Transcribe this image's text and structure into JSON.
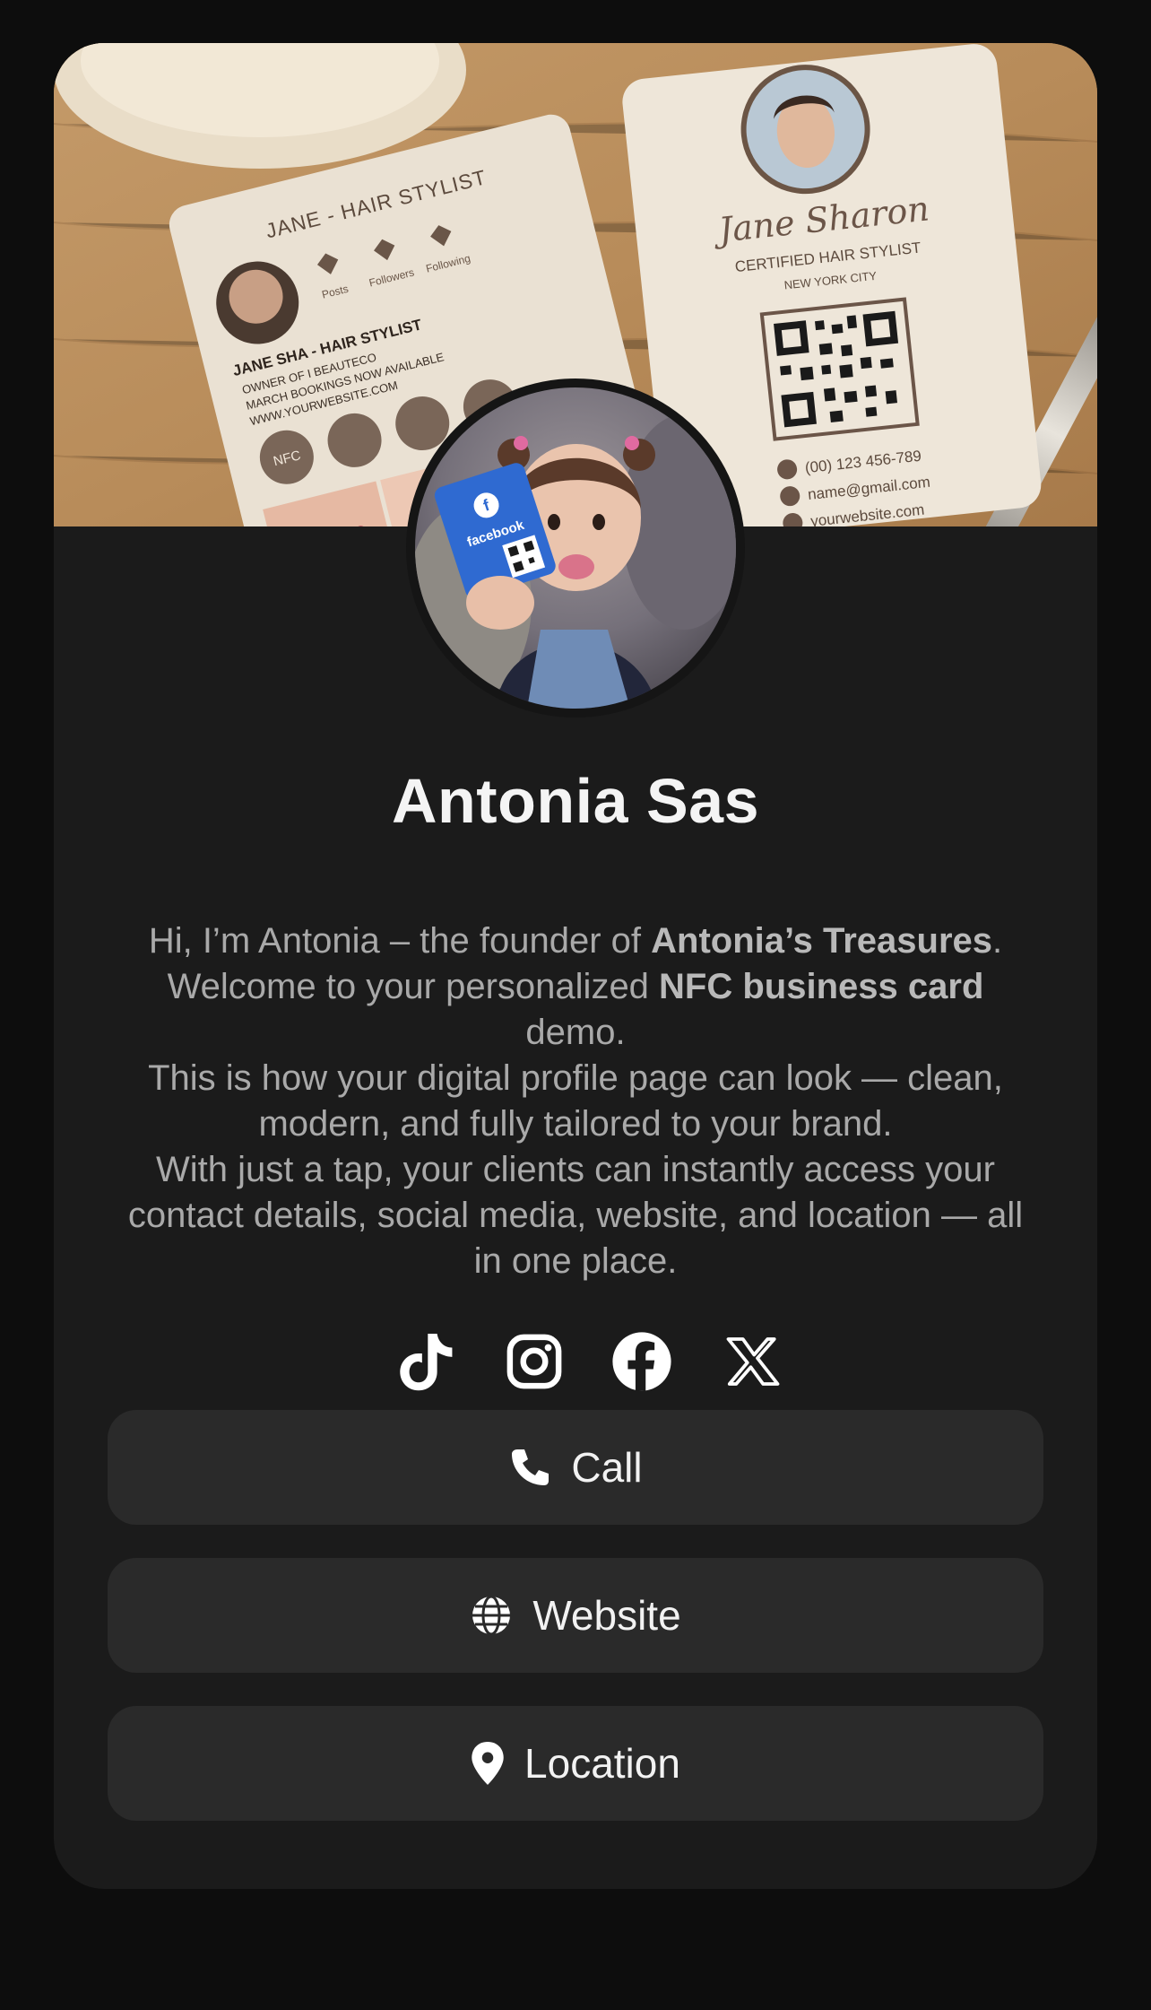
{
  "profile": {
    "name": "Antonia Sas",
    "bio": {
      "line1_prefix": "Hi, I’m Antonia – the founder of ",
      "brand": "Antonia’s Treasures",
      "line1_suffix": ".",
      "line2_prefix": "Welcome to your personalized ",
      "product": "NFC business card",
      "line2_suffix": " demo.",
      "paragraph2": "This is how your digital profile page can look — clean, modern, and fully tailored to your brand.",
      "paragraph3": "With just a tap, your clients can instantly access your contact details, social media, website, and location — all in one place."
    }
  },
  "cover_image": {
    "left_card": {
      "title": "JANE - HAIR STYLIST",
      "stats": [
        "Posts",
        "Followers",
        "Following"
      ],
      "heading": "JANE SHA - HAIR STYLIST",
      "bullets": [
        "OWNER OF I BEAUTECO",
        "MARCH BOOKINGS NOW AVAILABLE",
        "WWW.YOURWEBSITE.COM"
      ],
      "badge": "NFC"
    },
    "right_card": {
      "name": "Jane Sharon",
      "title": "CERTIFIED HAIR STYLIST",
      "city": "NEW YORK CITY",
      "phone": "(00) 123 456-789",
      "email": "name@gmail.com",
      "website": "yourwebsite.com"
    }
  },
  "avatar_image": {
    "card_label": "facebook"
  },
  "socials": [
    {
      "name": "tiktok",
      "icon": "tiktok-icon"
    },
    {
      "name": "instagram",
      "icon": "instagram-icon"
    },
    {
      "name": "facebook",
      "icon": "facebook-icon"
    },
    {
      "name": "x",
      "icon": "x-icon"
    }
  ],
  "actions": {
    "call_label": "Call",
    "call_icon": "phone-icon",
    "website_label": "Website",
    "website_icon": "globe-icon",
    "location_label": "Location",
    "location_icon": "map-pin-icon"
  },
  "colors": {
    "page_background": "#0d0d0d",
    "card_background": "#1b1b1b",
    "button_background": "#2a2a2a",
    "name_text": "#f4f4f4",
    "bio_text": "#a9a9a9"
  }
}
